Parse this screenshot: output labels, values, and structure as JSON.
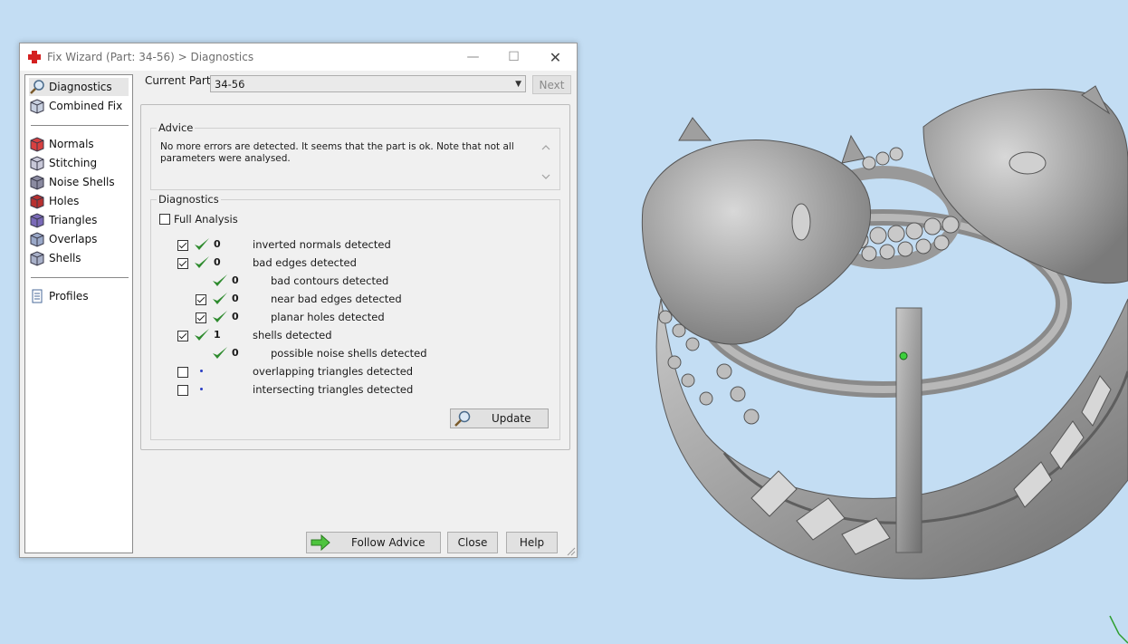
{
  "window": {
    "title": "Fix Wizard (Part: 34-56) > Diagnostics",
    "minimize_glyph": "—",
    "maximize_glyph": "☐",
    "close_glyph": "✕"
  },
  "nav": {
    "groups": [
      [
        {
          "label": "Diagnostics",
          "icon": "magnifier-icon",
          "selected": true
        },
        {
          "label": "Combined Fix",
          "icon": "combined-fix-icon",
          "selected": false
        }
      ],
      [
        {
          "label": "Normals",
          "icon": "normals-cube-icon",
          "selected": false
        },
        {
          "label": "Stitching",
          "icon": "stitching-cube-icon",
          "selected": false
        },
        {
          "label": "Noise Shells",
          "icon": "noise-shells-cube-icon",
          "selected": false
        },
        {
          "label": "Holes",
          "icon": "holes-cube-icon",
          "selected": false
        },
        {
          "label": "Triangles",
          "icon": "triangles-cube-icon",
          "selected": false
        },
        {
          "label": "Overlaps",
          "icon": "overlaps-cube-icon",
          "selected": false
        },
        {
          "label": "Shells",
          "icon": "shells-cube-icon",
          "selected": false
        }
      ],
      [
        {
          "label": "Profiles",
          "icon": "profiles-document-icon",
          "selected": false
        }
      ]
    ]
  },
  "current_part": {
    "label": "Current Part:",
    "value": "34-56",
    "next_label": "Next"
  },
  "advice": {
    "title": "Advice",
    "text": "No more errors are detected. It seems that the part is ok. Note that not all parameters were analysed."
  },
  "diagnostics": {
    "title": "Diagnostics",
    "full_analysis_label": "Full Analysis",
    "full_analysis_checked": false,
    "rows": [
      {
        "indent": 0,
        "has_checkbox": true,
        "checked": true,
        "status": "ok",
        "count": "0",
        "label": "inverted normals detected"
      },
      {
        "indent": 0,
        "has_checkbox": true,
        "checked": true,
        "status": "ok",
        "count": "0",
        "label": "bad edges detected"
      },
      {
        "indent": 1,
        "has_checkbox": false,
        "checked": false,
        "status": "ok",
        "count": "0",
        "label": "bad contours detected"
      },
      {
        "indent": 1,
        "has_checkbox": true,
        "checked": true,
        "status": "ok",
        "count": "0",
        "label": "near bad edges detected"
      },
      {
        "indent": 1,
        "has_checkbox": true,
        "checked": true,
        "status": "ok",
        "count": "0",
        "label": "planar holes detected"
      },
      {
        "indent": 0,
        "has_checkbox": true,
        "checked": true,
        "status": "ok",
        "count": "1",
        "label": "shells detected"
      },
      {
        "indent": 1,
        "has_checkbox": false,
        "checked": false,
        "status": "ok",
        "count": "0",
        "label": "possible noise shells detected"
      },
      {
        "indent": 0,
        "has_checkbox": true,
        "checked": false,
        "status": "pending",
        "count": "",
        "label": "overlapping triangles detected"
      },
      {
        "indent": 0,
        "has_checkbox": true,
        "checked": false,
        "status": "pending",
        "count": "",
        "label": "intersecting triangles detected"
      }
    ],
    "update_label": "Update"
  },
  "buttons": {
    "follow_advice": "Follow Advice",
    "close": "Close",
    "help": "Help"
  },
  "colors": {
    "viewport_bg": "#c3ddf3",
    "check_green": "#2e8b2e",
    "pending_dot": "#2b3fc4",
    "model_gray": "#9a9a9a"
  }
}
